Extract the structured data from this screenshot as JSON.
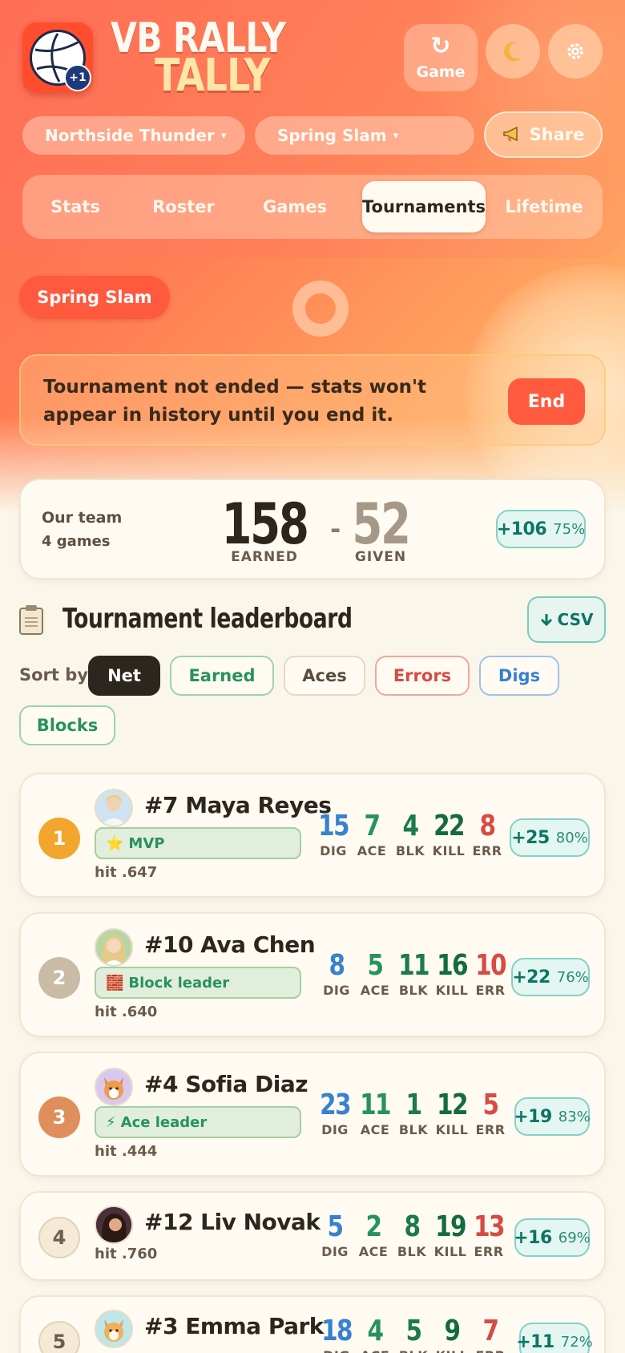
{
  "brand": {
    "line1": "VB RALLY",
    "line2": "TALLY",
    "logo_badge": "+1"
  },
  "header": {
    "game_button": {
      "icon": "↻",
      "label": "Game"
    },
    "theme_icon": "moon-icon",
    "settings_icon": "gear-icon",
    "team_select": "Northside Thunder",
    "tournament_select": "Spring Slam",
    "caret": "▾",
    "share_label": "Share"
  },
  "tabs": [
    {
      "label": "Stats",
      "active": false
    },
    {
      "label": "Roster",
      "active": false
    },
    {
      "label": "Games",
      "active": false
    },
    {
      "label": "Tournaments",
      "active": true
    },
    {
      "label": "Lifetime",
      "active": false
    }
  ],
  "tournament_chip": "Spring Slam",
  "warning": {
    "text": "Tournament not ended — stats won't appear in history until you end it.",
    "end_label": "End"
  },
  "summary": {
    "team": "Our team",
    "games": "4 games",
    "earned": "158",
    "earned_label": "EARNED",
    "separator": "-",
    "given": "52",
    "given_label": "GIVEN",
    "net": "+106",
    "pct": "75%"
  },
  "leaderboard": {
    "title": "Tournament leaderboard",
    "csv_label": "CSV",
    "sort_label": "Sort by",
    "sort_options": [
      "Net",
      "Earned",
      "Aces",
      "Errors",
      "Digs",
      "Blocks"
    ],
    "stat_labels": {
      "dig": "DIG",
      "ace": "ACE",
      "blk": "BLK",
      "kill": "KILL",
      "err": "ERR"
    },
    "players": [
      {
        "rank": "1",
        "name": "#7 Maya Reyes",
        "badge_icon": "⭐",
        "badge": "MVP",
        "hit": "hit .647",
        "dig": "15",
        "ace": "7",
        "blk": "4",
        "kill": "22",
        "err": "8",
        "net": "+25",
        "pct": "80%"
      },
      {
        "rank": "2",
        "name": "#10 Ava Chen",
        "badge_icon": "🧱",
        "badge": "Block leader",
        "hit": "hit .640",
        "dig": "8",
        "ace": "5",
        "blk": "11",
        "kill": "16",
        "err": "10",
        "net": "+22",
        "pct": "76%"
      },
      {
        "rank": "3",
        "name": "#4 Sofia Diaz",
        "badge_icon": "⚡",
        "badge": "Ace leader",
        "hit": "hit .444",
        "dig": "23",
        "ace": "11",
        "blk": "1",
        "kill": "12",
        "err": "5",
        "net": "+19",
        "pct": "83%"
      },
      {
        "rank": "4",
        "name": "#12 Liv Novak",
        "hit": "hit .760",
        "dig": "5",
        "ace": "2",
        "blk": "8",
        "kill": "19",
        "err": "13",
        "net": "+16",
        "pct": "69%"
      },
      {
        "rank": "5",
        "name": "#3 Emma Park",
        "dig": "18",
        "ace": "4",
        "blk": "5",
        "kill": "9",
        "err": "7",
        "net": "+11",
        "pct": "72%"
      }
    ]
  }
}
